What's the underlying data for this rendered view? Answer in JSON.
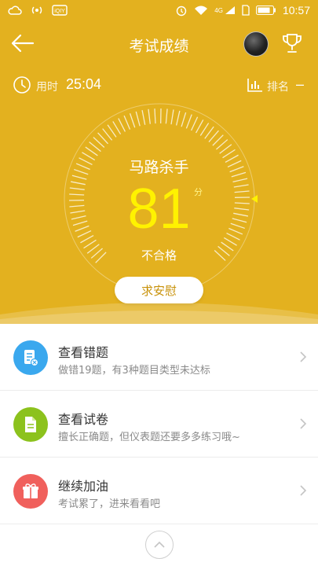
{
  "status_bar": {
    "time": "10:57",
    "network": "4G",
    "app_badge": "iQIY"
  },
  "header": {
    "title": "考试成绩"
  },
  "stats": {
    "duration_label": "用时",
    "duration_value": "25:04",
    "rank_label": "排名",
    "rank_value": "–"
  },
  "result": {
    "grade_title": "马路杀手",
    "score": "81",
    "score_unit": "分",
    "pass_status": "不合格",
    "comfort_button": "求安慰"
  },
  "actions": [
    {
      "title": "查看错题",
      "subtitle": "做错19题，有3种题目类型未达标",
      "icon": "wrong-questions-icon",
      "color": "#3aa8ee"
    },
    {
      "title": "查看试卷",
      "subtitle": "擅长正确题，但仪表题还要多多练习哦~",
      "icon": "paper-icon",
      "color": "#8cc21d"
    },
    {
      "title": "继续加油",
      "subtitle": "考试累了，进来看看吧",
      "icon": "gift-icon",
      "color": "#f0605c"
    }
  ],
  "colors": {
    "theme_yellow": "#e3b11f",
    "score_yellow": "#fff200"
  }
}
